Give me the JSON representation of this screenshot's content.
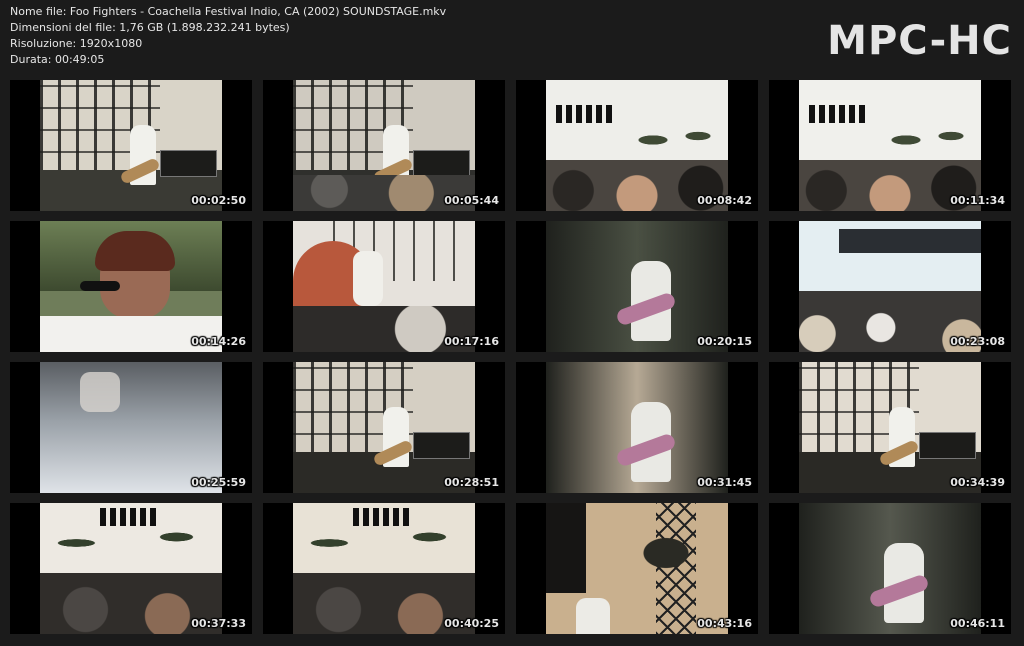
{
  "file_info": {
    "name_line": "Nome file: Foo Fighters - Coachella Festival Indio, CA (2002) SOUNDSTAGE.mkv",
    "size_line": "Dimensioni del file: 1,76 GB (1.898.232.241 bytes)",
    "resolution_line": "Risoluzione: 1920x1080",
    "duration_line": "Durata: 00:49:05"
  },
  "brand": "MPC-HC",
  "thumbnails": [
    {
      "timestamp": "00:02:50",
      "scene": "stage-band",
      "sky": "#d9d4c8",
      "tone": "#3a3a34"
    },
    {
      "timestamp": "00:05:44",
      "scene": "stage-crowd",
      "sky": "#cfcac0",
      "tone": "#2f2f2c"
    },
    {
      "timestamp": "00:08:42",
      "scene": "lights-crowd",
      "sky": "#eeeeea",
      "tone": "#2b2622"
    },
    {
      "timestamp": "00:11:34",
      "scene": "lights-crowd",
      "sky": "#f0f0ec",
      "tone": "#2a2824"
    },
    {
      "timestamp": "00:14:26",
      "scene": "closeup-singer",
      "sky": "#6f7d5a",
      "tone": "#5a2a1e"
    },
    {
      "timestamp": "00:17:16",
      "scene": "crowd-cap",
      "sky": "#e6e2dc",
      "tone": "#6a2d20"
    },
    {
      "timestamp": "00:20:15",
      "scene": "dark-guitarist",
      "sky": "#4a5043",
      "tone": "#1b1d19"
    },
    {
      "timestamp": "00:23:08",
      "scene": "wide-crowd",
      "sky": "#e4eef2",
      "tone": "#333230"
    },
    {
      "timestamp": "00:25:59",
      "scene": "blurry-stage",
      "sky": "#8a8f96",
      "tone": "#4b4f55"
    },
    {
      "timestamp": "00:28:51",
      "scene": "stage-guitarist",
      "sky": "#d5cfc3",
      "tone": "#2b2a26"
    },
    {
      "timestamp": "00:31:45",
      "scene": "dark-guitarist",
      "sky": "#b6a995",
      "tone": "#262420"
    },
    {
      "timestamp": "00:34:39",
      "scene": "stage-guitarist",
      "sky": "#e1dbd0",
      "tone": "#2a2925"
    },
    {
      "timestamp": "00:37:33",
      "scene": "palm-crowd",
      "sky": "#ede9e2",
      "tone": "#2e2a26"
    },
    {
      "timestamp": "00:40:25",
      "scene": "palm-crowd",
      "sky": "#e8e2d6",
      "tone": "#2c2926"
    },
    {
      "timestamp": "00:43:16",
      "scene": "sunset-tower",
      "sky": "#c9b08e",
      "tone": "#1f1d1a"
    },
    {
      "timestamp": "00:46:11",
      "scene": "dark-performer",
      "sky": "#55584e",
      "tone": "#1e201c"
    }
  ]
}
